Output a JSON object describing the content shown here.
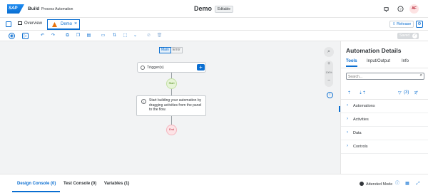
{
  "shell": {
    "logo_text": "SAP",
    "brand": "Build",
    "product": "Process Automation",
    "project_title": "Demo",
    "status_badge": "Editable",
    "avatar_initials": "AF"
  },
  "tabs": {
    "overview_label": "Overview",
    "demo_label": "Demo"
  },
  "actions": {
    "release_label": "Release",
    "saved_label": "Saved"
  },
  "canvas": {
    "segment_main": "Main",
    "segment_error": "Error",
    "trigger_label": "Trigger(s)",
    "start_label": "Start",
    "hint_text": "Start building your automation by dragging activities from the panel to the flow.",
    "end_label": "End",
    "zoom_percent": "100%"
  },
  "panel": {
    "title": "Automation Details",
    "tabs": [
      "Tools",
      "Input/Output",
      "Info"
    ],
    "search_placeholder": "Search...",
    "filter_count": "(3)",
    "categories": [
      "Automations",
      "Activities",
      "Data",
      "Controls"
    ]
  },
  "console": {
    "tabs": [
      "Design Console (0)",
      "Test Console (0)",
      "Variables (1)"
    ],
    "mode_label": "Attended Mode"
  }
}
